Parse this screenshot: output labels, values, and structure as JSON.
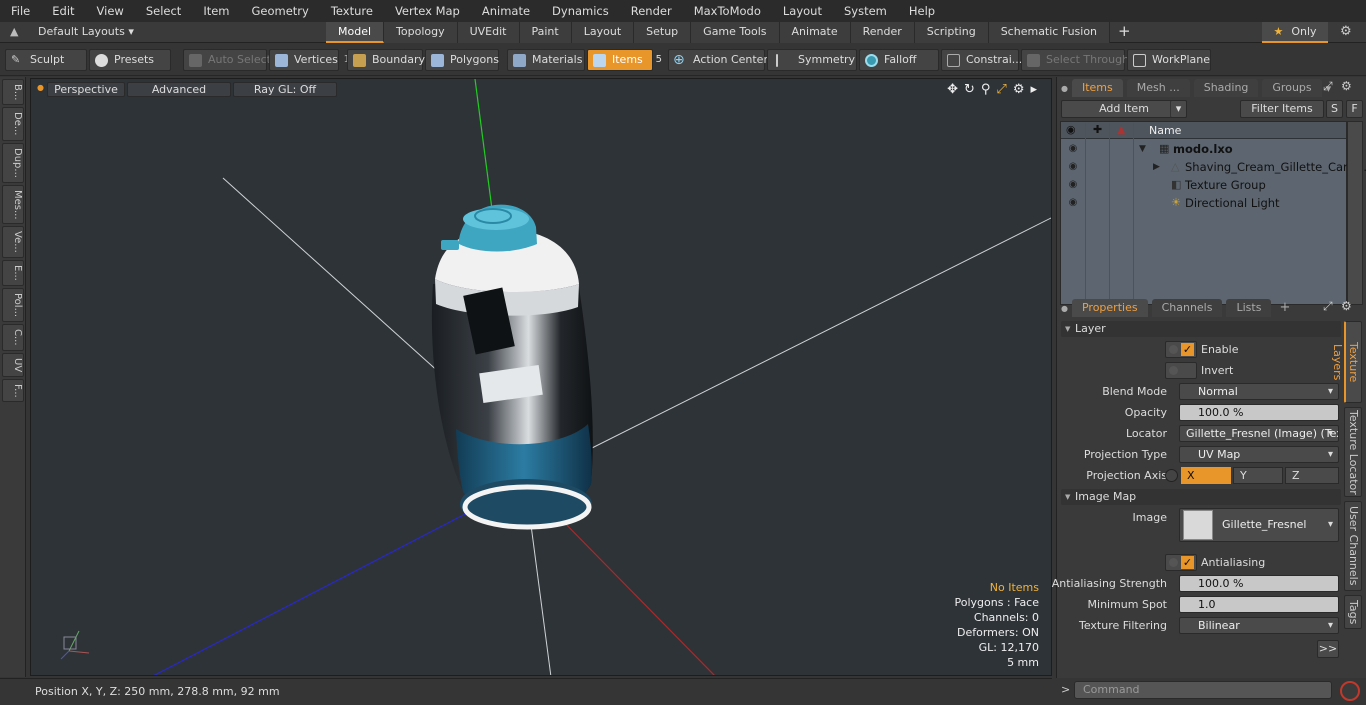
{
  "menubar": [
    "File",
    "Edit",
    "View",
    "Select",
    "Item",
    "Geometry",
    "Texture",
    "Vertex Map",
    "Animate",
    "Dynamics",
    "Render",
    "MaxToModo",
    "Layout",
    "System",
    "Help"
  ],
  "layoutbar": {
    "layout_label": "Default Layouts",
    "tabs": [
      "Model",
      "Topology",
      "UVEdit",
      "Paint",
      "Layout",
      "Setup",
      "Game Tools",
      "Animate",
      "Render",
      "Scripting",
      "Schematic Fusion"
    ],
    "active_tab": "Model",
    "only_label": "Only"
  },
  "toolbar": {
    "sculpt": "Sculpt",
    "presets": "Presets",
    "auto_select": "Auto Select",
    "vertices": "Vertices",
    "vertices_count": "1",
    "boundary": "Boundary",
    "polygons": "Polygons",
    "materials": "Materials",
    "items": "Items",
    "items_count": "5",
    "action_center": "Action Center",
    "symmetry": "Symmetry",
    "falloff": "Falloff",
    "constraints": "Constrai...",
    "select_through": "Select Through",
    "workplane": "WorkPlane"
  },
  "left_tabs": [
    "B...",
    "De...",
    "Dup...",
    "Mes...",
    "Ve...",
    "E...",
    "Pol...",
    "C...",
    "UV",
    "F..."
  ],
  "viewport": {
    "perspective": "Perspective",
    "advanced": "Advanced",
    "raygl": "Ray GL: Off",
    "hud": {
      "no_items": "No Items",
      "polygons": "Polygons : Face",
      "channels": "Channels: 0",
      "deformers": "Deformers: ON",
      "gl": "GL: 12,170",
      "scale": "5 mm"
    }
  },
  "status": {
    "position": "Position X, Y, Z:   250 mm, 278.8 mm, 92 mm"
  },
  "items_panel": {
    "tabs": [
      "Items",
      "Mesh ...",
      "Shading",
      "Groups"
    ],
    "add_item": "Add Item",
    "filter_items": "Filter Items",
    "s_btn": "S",
    "f_btn": "F",
    "name_header": "Name",
    "rows": [
      {
        "name": "modo.lxo"
      },
      {
        "name": "Shaving_Cream_Gillette_Can_ ..."
      },
      {
        "name": "Texture Group"
      },
      {
        "name": "Directional Light"
      }
    ]
  },
  "properties": {
    "tabs": [
      "Properties",
      "Channels",
      "Lists"
    ],
    "layer_section": "Layer",
    "enable": "Enable",
    "invert": "Invert",
    "blend_mode_label": "Blend Mode",
    "blend_mode": "Normal",
    "opacity_label": "Opacity",
    "opacity": "100.0 %",
    "locator_label": "Locator",
    "locator": "Gillette_Fresnel (Image) (Tex ...",
    "projection_type_label": "Projection Type",
    "projection_type": "UV Map",
    "projection_axis_label": "Projection Axis",
    "axis_x": "X",
    "axis_y": "Y",
    "axis_z": "Z",
    "image_map_section": "Image Map",
    "image_label": "Image",
    "image": "Gillette_Fresnel",
    "antialiasing": "Antialiasing",
    "aa_strength_label": "Antialiasing Strength",
    "aa_strength": "100.0 %",
    "min_spot_label": "Minimum Spot",
    "min_spot": "1.0",
    "tex_filter_label": "Texture Filtering",
    "tex_filter": "Bilinear",
    "more": ">>",
    "side_tabs": [
      "Texture Layers",
      "Texture Locator",
      "User Channels",
      "Tags"
    ]
  },
  "command": {
    "placeholder": "Command"
  },
  "colors": {
    "accent": "#e8952a",
    "viewport_bg": "#2e3338",
    "can_blue": "#3fa6c2"
  }
}
